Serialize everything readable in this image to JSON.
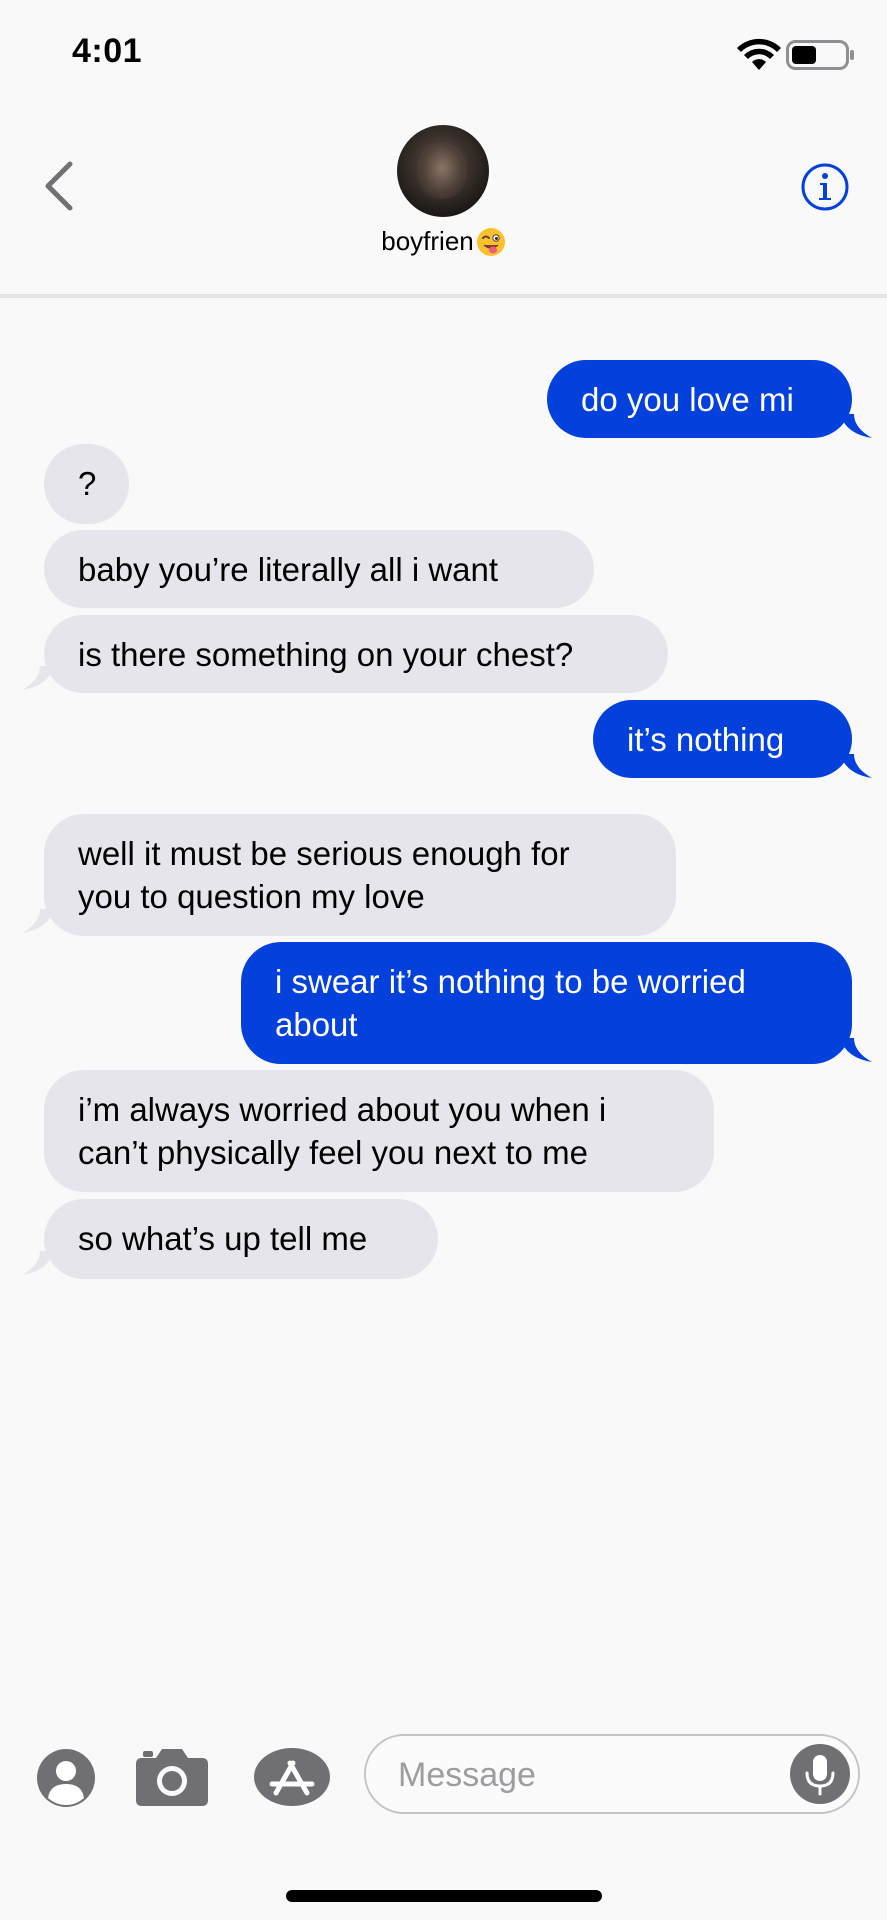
{
  "status_bar": {
    "time": "4:01",
    "wifi_icon": "wifi-icon",
    "battery_icon": "battery-icon"
  },
  "header": {
    "contact_name": "boyfrien",
    "contact_emoji": "winking-face-with-tongue",
    "back_icon": "chevron-left-icon",
    "info_icon": "info-icon",
    "accent_color": "#0340dc"
  },
  "messages": [
    {
      "direction": "sent",
      "text": "do you love mi"
    },
    {
      "direction": "received",
      "text": "?"
    },
    {
      "direction": "received",
      "text": "baby you’re literally all i want"
    },
    {
      "direction": "received",
      "text": "is there something on your chest?"
    },
    {
      "direction": "sent",
      "text": "it’s nothing"
    },
    {
      "direction": "received",
      "text": "well it must be serious enough for\nyou to question my love"
    },
    {
      "direction": "sent",
      "text": "i swear it’s nothing to be worried\nabout"
    },
    {
      "direction": "received",
      "text": "i’m always worried about you when i\ncan’t physically feel you next to me"
    },
    {
      "direction": "received",
      "text": "so what’s up tell me"
    }
  ],
  "composer": {
    "placeholder": "Message",
    "value": "",
    "contact_icon": "person-icon",
    "camera_icon": "camera-icon",
    "appstore_icon": "app-store-icon",
    "mic_icon": "microphone-icon"
  },
  "colors": {
    "sent_bubble": "#0340dc",
    "received_bubble": "#e6e5eb",
    "background": "#f9f9fa"
  }
}
